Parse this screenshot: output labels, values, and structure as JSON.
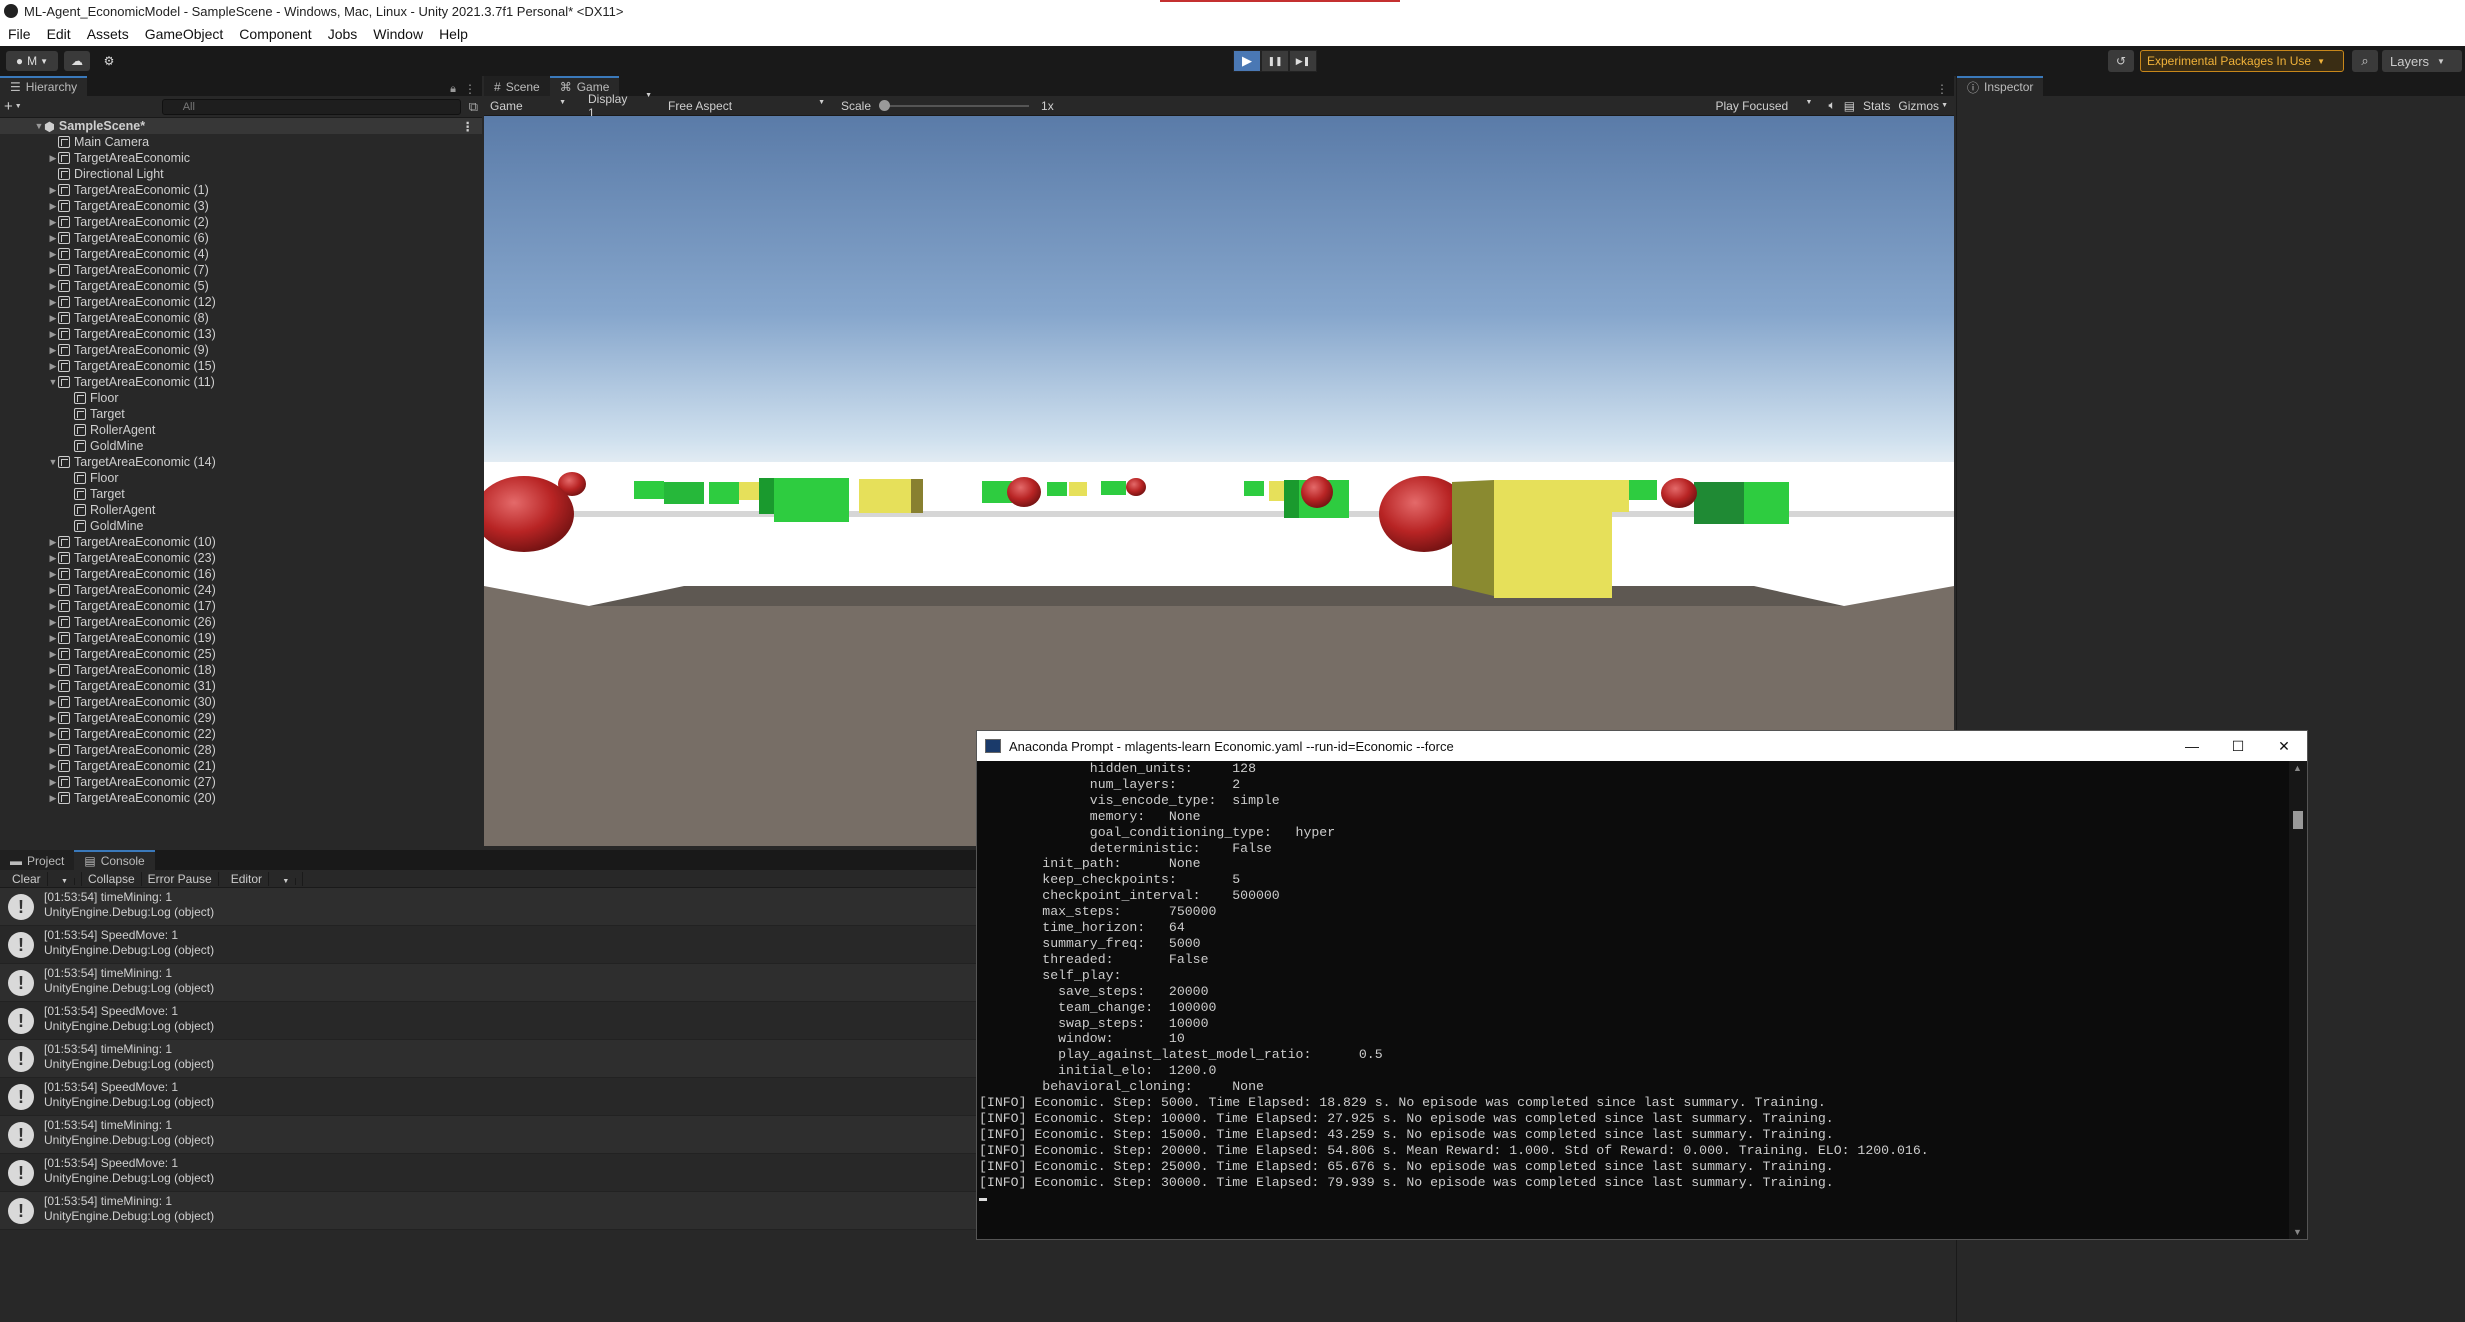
{
  "window": {
    "title": "ML-Agent_EconomicModel - SampleScene - Windows, Mac, Linux - Unity 2021.3.7f1 Personal* <DX11>"
  },
  "menu": [
    "File",
    "Edit",
    "Assets",
    "GameObject",
    "Component",
    "Jobs",
    "Window",
    "Help"
  ],
  "toolbar": {
    "account": "M",
    "experimental": "Experimental Packages In Use",
    "layers": "Layers",
    "play_icon": "▶",
    "pause_icon": "❚❚",
    "step_icon": "▶❚"
  },
  "hierarchy": {
    "tab": "Hierarchy",
    "search_placeholder": "All",
    "scene": "SampleScene*",
    "items": [
      {
        "label": "Main Camera",
        "depth": 1,
        "arrow": ""
      },
      {
        "label": "TargetAreaEconomic",
        "depth": 1,
        "arrow": "▶"
      },
      {
        "label": "Directional Light",
        "depth": 1,
        "arrow": ""
      },
      {
        "label": "TargetAreaEconomic (1)",
        "depth": 1,
        "arrow": "▶"
      },
      {
        "label": "TargetAreaEconomic (3)",
        "depth": 1,
        "arrow": "▶"
      },
      {
        "label": "TargetAreaEconomic (2)",
        "depth": 1,
        "arrow": "▶"
      },
      {
        "label": "TargetAreaEconomic (6)",
        "depth": 1,
        "arrow": "▶"
      },
      {
        "label": "TargetAreaEconomic (4)",
        "depth": 1,
        "arrow": "▶"
      },
      {
        "label": "TargetAreaEconomic (7)",
        "depth": 1,
        "arrow": "▶"
      },
      {
        "label": "TargetAreaEconomic (5)",
        "depth": 1,
        "arrow": "▶"
      },
      {
        "label": "TargetAreaEconomic (12)",
        "depth": 1,
        "arrow": "▶"
      },
      {
        "label": "TargetAreaEconomic (8)",
        "depth": 1,
        "arrow": "▶"
      },
      {
        "label": "TargetAreaEconomic (13)",
        "depth": 1,
        "arrow": "▶"
      },
      {
        "label": "TargetAreaEconomic (9)",
        "depth": 1,
        "arrow": "▶"
      },
      {
        "label": "TargetAreaEconomic (15)",
        "depth": 1,
        "arrow": "▶"
      },
      {
        "label": "TargetAreaEconomic (11)",
        "depth": 1,
        "arrow": "▼"
      },
      {
        "label": "Floor",
        "depth": 2,
        "arrow": ""
      },
      {
        "label": "Target",
        "depth": 2,
        "arrow": ""
      },
      {
        "label": "RollerAgent",
        "depth": 2,
        "arrow": ""
      },
      {
        "label": "GoldMine",
        "depth": 2,
        "arrow": ""
      },
      {
        "label": "TargetAreaEconomic (14)",
        "depth": 1,
        "arrow": "▼"
      },
      {
        "label": "Floor",
        "depth": 2,
        "arrow": ""
      },
      {
        "label": "Target",
        "depth": 2,
        "arrow": ""
      },
      {
        "label": "RollerAgent",
        "depth": 2,
        "arrow": ""
      },
      {
        "label": "GoldMine",
        "depth": 2,
        "arrow": ""
      },
      {
        "label": "TargetAreaEconomic (10)",
        "depth": 1,
        "arrow": "▶"
      },
      {
        "label": "TargetAreaEconomic (23)",
        "depth": 1,
        "arrow": "▶"
      },
      {
        "label": "TargetAreaEconomic (16)",
        "depth": 1,
        "arrow": "▶"
      },
      {
        "label": "TargetAreaEconomic (24)",
        "depth": 1,
        "arrow": "▶"
      },
      {
        "label": "TargetAreaEconomic (17)",
        "depth": 1,
        "arrow": "▶"
      },
      {
        "label": "TargetAreaEconomic (26)",
        "depth": 1,
        "arrow": "▶"
      },
      {
        "label": "TargetAreaEconomic (19)",
        "depth": 1,
        "arrow": "▶"
      },
      {
        "label": "TargetAreaEconomic (25)",
        "depth": 1,
        "arrow": "▶"
      },
      {
        "label": "TargetAreaEconomic (18)",
        "depth": 1,
        "arrow": "▶"
      },
      {
        "label": "TargetAreaEconomic (31)",
        "depth": 1,
        "arrow": "▶"
      },
      {
        "label": "TargetAreaEconomic (30)",
        "depth": 1,
        "arrow": "▶"
      },
      {
        "label": "TargetAreaEconomic (29)",
        "depth": 1,
        "arrow": "▶"
      },
      {
        "label": "TargetAreaEconomic (22)",
        "depth": 1,
        "arrow": "▶"
      },
      {
        "label": "TargetAreaEconomic (28)",
        "depth": 1,
        "arrow": "▶"
      },
      {
        "label": "TargetAreaEconomic (21)",
        "depth": 1,
        "arrow": "▶"
      },
      {
        "label": "TargetAreaEconomic (27)",
        "depth": 1,
        "arrow": "▶"
      },
      {
        "label": "TargetAreaEconomic (20)",
        "depth": 1,
        "arrow": "▶"
      }
    ]
  },
  "game_view": {
    "tabs": [
      "Scene",
      "Game"
    ],
    "active_tab": "Game",
    "mode": "Game",
    "display": "Display 1",
    "aspect": "Free Aspect",
    "scale_label": "Scale",
    "scale_value": "1x",
    "play_focused": "Play Focused",
    "stats": "Stats",
    "gizmos": "Gizmos"
  },
  "inspector": {
    "tab": "Inspector"
  },
  "console": {
    "tabs": [
      "Project",
      "Console"
    ],
    "toolbar": [
      "Clear",
      "Collapse",
      "Error Pause",
      "Editor"
    ],
    "logs": [
      {
        "line1": "[01:53:54] timeMining: 1",
        "line2": "UnityEngine.Debug:Log (object)"
      },
      {
        "line1": "[01:53:54] SpeedMove: 1",
        "line2": "UnityEngine.Debug:Log (object)"
      },
      {
        "line1": "[01:53:54] timeMining: 1",
        "line2": "UnityEngine.Debug:Log (object)"
      },
      {
        "line1": "[01:53:54] SpeedMove: 1",
        "line2": "UnityEngine.Debug:Log (object)"
      },
      {
        "line1": "[01:53:54] timeMining: 1",
        "line2": "UnityEngine.Debug:Log (object)"
      },
      {
        "line1": "[01:53:54] SpeedMove: 1",
        "line2": "UnityEngine.Debug:Log (object)"
      },
      {
        "line1": "[01:53:54] timeMining: 1",
        "line2": "UnityEngine.Debug:Log (object)"
      },
      {
        "line1": "[01:53:54] SpeedMove: 1",
        "line2": "UnityEngine.Debug:Log (object)"
      },
      {
        "line1": "[01:53:54] timeMining: 1",
        "line2": "UnityEngine.Debug:Log (object)"
      }
    ]
  },
  "terminal": {
    "title": "Anaconda Prompt - mlagents-learn  Economic.yaml --run-id=Economic --force",
    "lines": [
      "              hidden_units:     128",
      "              num_layers:       2",
      "              vis_encode_type:  simple",
      "              memory:   None",
      "              goal_conditioning_type:   hyper",
      "              deterministic:    False",
      "        init_path:      None",
      "        keep_checkpoints:       5",
      "        checkpoint_interval:    500000",
      "        max_steps:      750000",
      "        time_horizon:   64",
      "        summary_freq:   5000",
      "        threaded:       False",
      "        self_play:",
      "          save_steps:   20000",
      "          team_change:  100000",
      "          swap_steps:   10000",
      "          window:       10",
      "          play_against_latest_model_ratio:      0.5",
      "          initial_elo:  1200.0",
      "        behavioral_cloning:     None",
      "[INFO] Economic. Step: 5000. Time Elapsed: 18.829 s. No episode was completed since last summary. Training.",
      "[INFO] Economic. Step: 10000. Time Elapsed: 27.925 s. No episode was completed since last summary. Training.",
      "[INFO] Economic. Step: 15000. Time Elapsed: 43.259 s. No episode was completed since last summary. Training.",
      "[INFO] Economic. Step: 20000. Time Elapsed: 54.806 s. Mean Reward: 1.000. Std of Reward: 0.000. Training. ELO: 1200.016.",
      "[INFO] Economic. Step: 25000. Time Elapsed: 65.676 s. No episode was completed since last summary. Training.",
      "[INFO] Economic. Step: 30000. Time Elapsed: 79.939 s. No episode was completed since last summary. Training."
    ]
  }
}
